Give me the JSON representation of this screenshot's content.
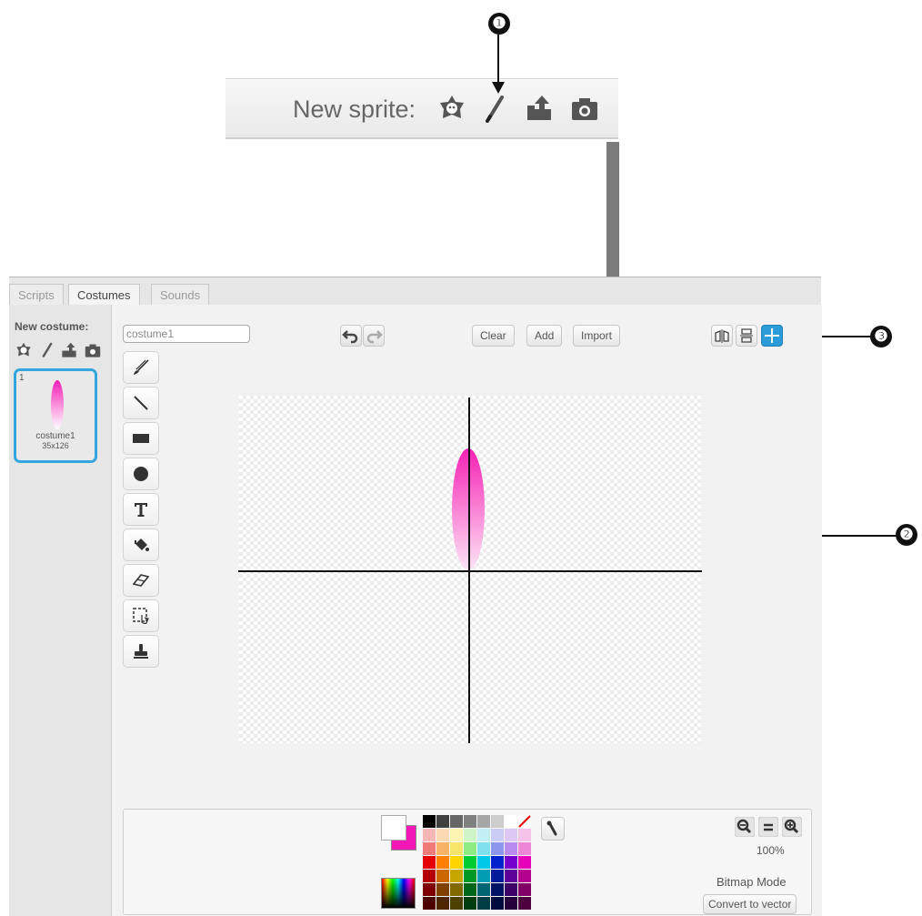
{
  "sprite_bar": {
    "label": "New sprite:",
    "icons": [
      "sprite-library-icon",
      "paint-brush-icon",
      "upload-icon",
      "camera-icon"
    ]
  },
  "callouts": [
    "❶",
    "❷",
    "❸"
  ],
  "tabs": [
    {
      "label": "Scripts",
      "active": false
    },
    {
      "label": "Costumes",
      "active": true
    },
    {
      "label": "Sounds",
      "active": false
    }
  ],
  "new_costume": {
    "label": "New costume:",
    "icons": [
      "costume-library-icon",
      "paint-brush-icon",
      "upload-icon",
      "camera-icon"
    ]
  },
  "costumes": [
    {
      "number": "1",
      "name": "costume1",
      "size": "35x126"
    }
  ],
  "editor": {
    "name_value": "costume1",
    "buttons": {
      "clear": "Clear",
      "add": "Add",
      "import": "Import"
    },
    "tools": [
      "brush-icon",
      "line-icon",
      "rectangle-icon",
      "ellipse-icon",
      "text-icon",
      "fill-icon",
      "eraser-icon",
      "select-icon",
      "stamp-icon"
    ],
    "right_tools": [
      "flip-horizontal-icon",
      "flip-vertical-icon",
      "set-costume-center-icon"
    ],
    "zoom": "100%",
    "mode": "Bitmap Mode",
    "convert_label": "Convert to vector"
  },
  "colors": {
    "accent": "#2c9bd9",
    "primary": "#ffffff",
    "secondary": "#f218b5"
  }
}
